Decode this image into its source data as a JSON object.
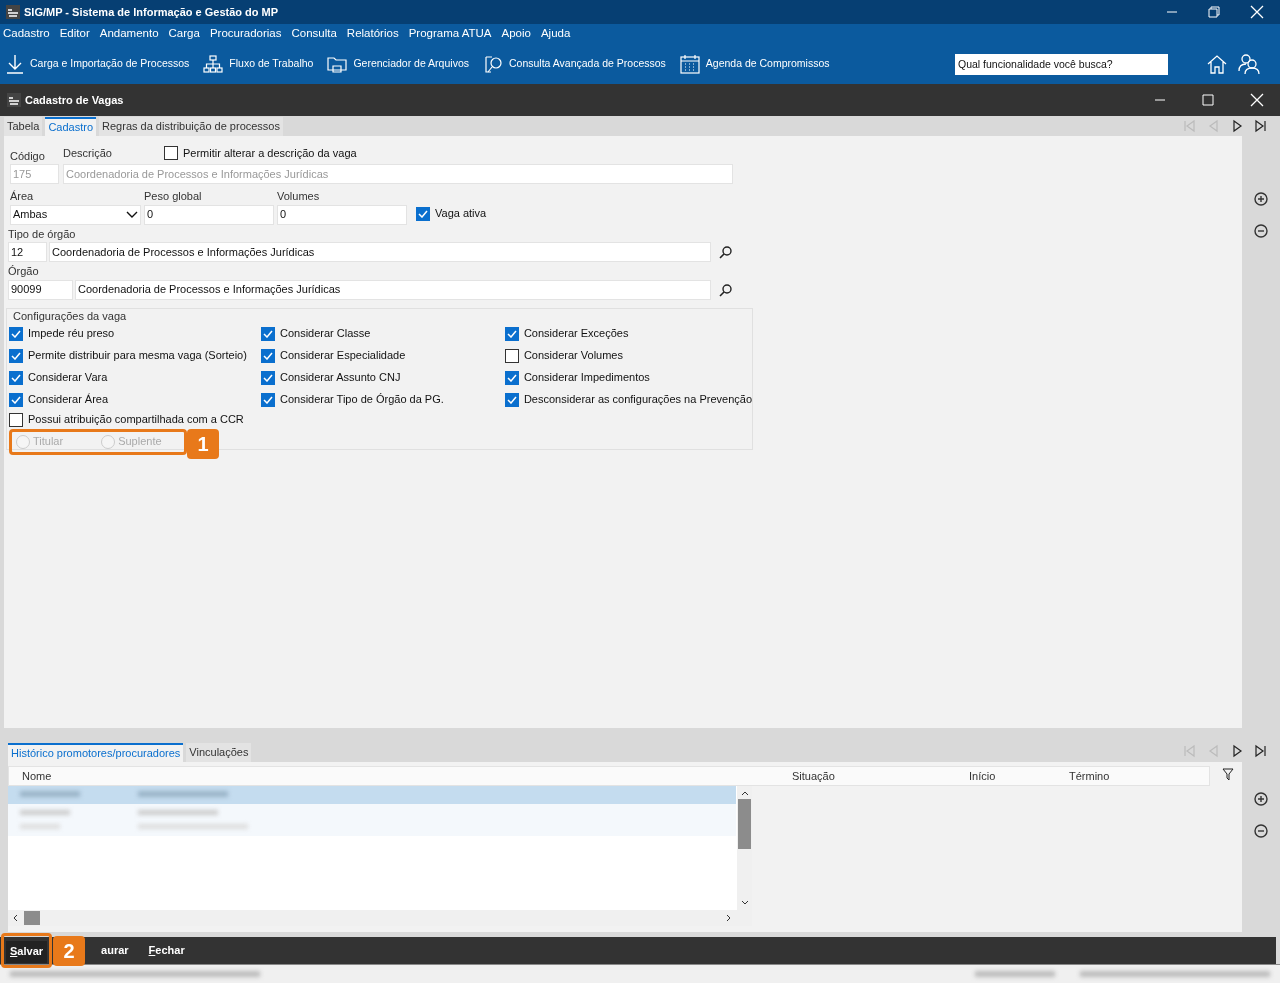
{
  "window": {
    "title": "SIG/MP - Sistema de Informação e Gestão do MP"
  },
  "menu": [
    "Cadastro",
    "Editor",
    "Andamento",
    "Carga",
    "Procuradorias",
    "Consulta",
    "Relatórios",
    "Programa ATUA",
    "Apoio",
    "Ajuda"
  ],
  "toolbar": [
    "Carga e Importação de Processos",
    "Fluxo de Trabalho",
    "Gerenciador de Arquivos",
    "Consulta Avançada de Processos",
    "Agenda de Compromissos"
  ],
  "search": {
    "placeholder": "Qual funcionalidade você busca?"
  },
  "form_window": {
    "title": "Cadastro de Vagas"
  },
  "tabs": [
    {
      "label": "Tabela",
      "selected": false
    },
    {
      "label": "Cadastro",
      "selected": true
    },
    {
      "label": "Regras da distribuição de processos",
      "selected": false
    }
  ],
  "record_nav": [
    {
      "disabled": true
    },
    {
      "disabled": true
    },
    {
      "disabled": false
    },
    {
      "disabled": false
    }
  ],
  "fields": {
    "codigo": {
      "label": "Código",
      "value": "175",
      "disabled": true
    },
    "descricao": {
      "label": "Descrição",
      "value": "Coordenadoria de Processos e Informações Jurídicas",
      "disabled": true
    },
    "allow_edit": {
      "label": "Permitir alterar a descrição da vaga",
      "checked": false
    },
    "area": {
      "label": "Área",
      "value": "Ambas"
    },
    "peso": {
      "label": "Peso global",
      "value": "0"
    },
    "volumes": {
      "label": "Volumes",
      "value": "0"
    },
    "ativa": {
      "label": "Vaga ativa",
      "checked": true
    },
    "tipo_orgao": {
      "label": "Tipo de órgão",
      "code": "12",
      "name": "Coordenadoria de Processos e Informações Jurídicas"
    },
    "orgao": {
      "label": "Órgão",
      "code": "90099",
      "name": "Coordenadoria de Processos e Informações Jurídicas"
    }
  },
  "config": {
    "title": "Configurações da vaga",
    "columns": [
      [
        {
          "label": "Impede réu preso",
          "checked": true
        },
        {
          "label": "Permite distribuir para mesma vaga (Sorteio)",
          "checked": true
        },
        {
          "label": "Considerar Vara",
          "checked": true
        },
        {
          "label": "Considerar Área",
          "checked": true
        }
      ],
      [
        {
          "label": "Considerar Classe",
          "checked": true
        },
        {
          "label": "Considerar Especialidade",
          "checked": true
        },
        {
          "label": "Considerar Assunto CNJ",
          "checked": true
        },
        {
          "label": "Considerar Tipo de Órgão da PG.",
          "checked": true
        }
      ],
      [
        {
          "label": "Considerar Exceções",
          "checked": true
        },
        {
          "label": "Considerar Volumes",
          "checked": false
        },
        {
          "label": "Considerar Impedimentos",
          "checked": true
        },
        {
          "label": "Desconsiderar as configurações na Prevenção",
          "checked": true
        }
      ]
    ],
    "shared": {
      "label": "Possui atribuição compartilhada com a CCR",
      "checked": false
    },
    "radios": [
      {
        "label": "Titular",
        "selected": false,
        "disabled": true
      },
      {
        "label": "Suplente",
        "selected": false,
        "disabled": true
      }
    ]
  },
  "bottom_tabs": [
    {
      "label": "Histórico promotores/procuradores",
      "selected": true
    },
    {
      "label": "Vinculações",
      "selected": false
    }
  ],
  "table": {
    "columns": [
      "Nome",
      "Situação",
      "Início",
      "Término"
    ]
  },
  "buttons": [
    {
      "label": "Salvar",
      "mnemonic": true
    },
    {
      "label": "aurar",
      "mnemonic": false
    },
    {
      "label": "Fechar",
      "mnemonic": true
    }
  ],
  "callouts": [
    "1",
    "2"
  ]
}
